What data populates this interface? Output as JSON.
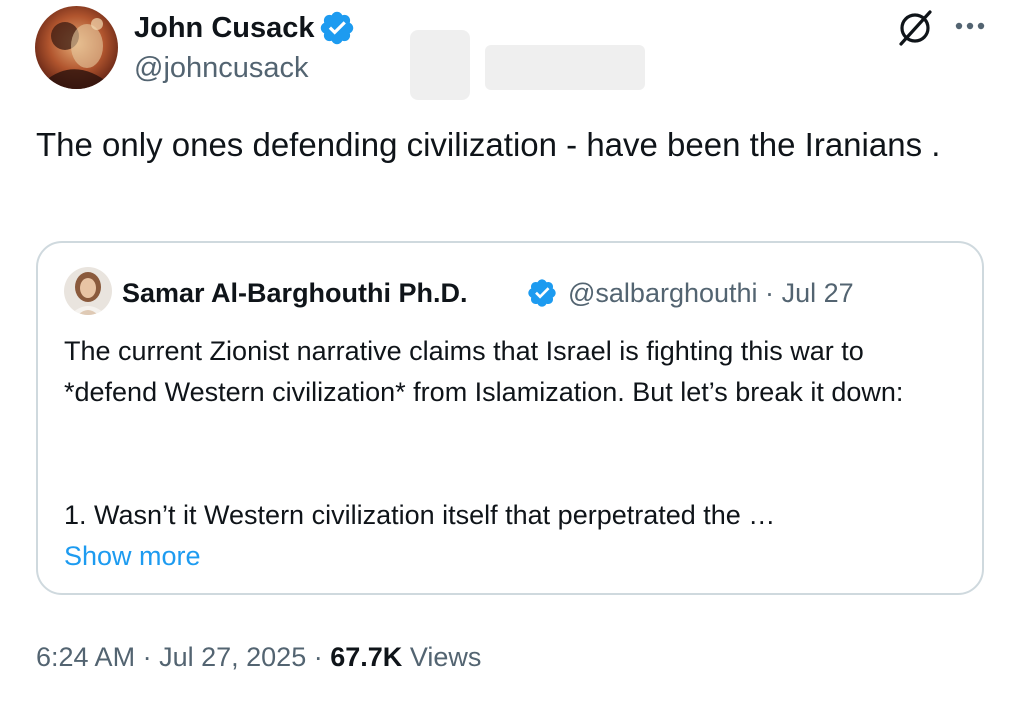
{
  "colors": {
    "text_primary": "#0f1419",
    "text_secondary": "#536471",
    "accent_link": "#1d9bf0",
    "verified_badge": "#1d9bf0",
    "card_border": "#cfd9de"
  },
  "icons": {
    "author_verified": "verified-badge-icon",
    "grok": "grok-icon",
    "more": "more-options-icon",
    "quote_verified": "verified-badge-icon"
  },
  "author": {
    "name": "John Cusack",
    "handle": "@johncusack"
  },
  "tweet": {
    "text": "The only ones defending civilization - have been the Iranians ."
  },
  "quote": {
    "name": "Samar Al-Barghouthi Ph.D.",
    "handle": "@salbarghouthi",
    "separator": "·",
    "date": "Jul 27",
    "text": "The current Zionist narrative claims that Israel is fighting this war to *defend Western civilization* from Islamization. But let’s break it down:",
    "truncated_line": "1. Wasn’t it Western civilization itself that perpetrated the …",
    "show_more": "Show more"
  },
  "footer": {
    "time": "6:24 AM",
    "sep1": "·",
    "date": "Jul 27, 2025",
    "sep2": "·",
    "views_count": "67.7K",
    "views_label": "Views"
  }
}
